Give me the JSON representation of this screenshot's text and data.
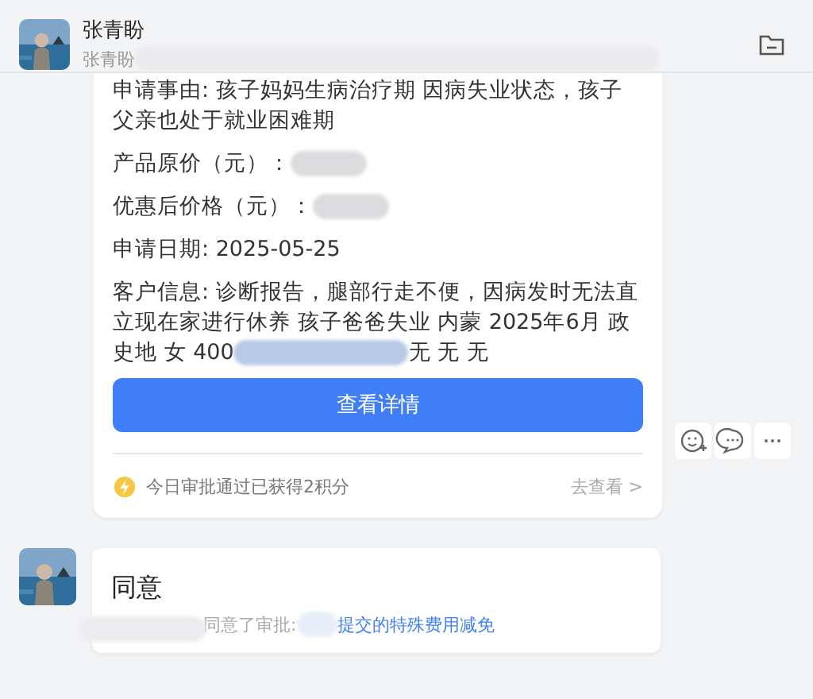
{
  "header": {
    "name": "张青盼",
    "subtitle": "张青盼"
  },
  "approval_card": {
    "fields": [
      {
        "parts": [
          "申请事由: 孩子妈妈生病治疗期 因病失业状态，孩子父亲也处于就业困难期"
        ],
        "redacted_end": false
      },
      {
        "parts": [
          "产品原价（元）："
        ],
        "redacted_end": true
      },
      {
        "parts": [
          "优惠后价格（元）："
        ],
        "redacted_end": true
      },
      {
        "parts": [
          "申请日期: 2025-05-25"
        ],
        "redacted_end": false
      },
      {
        "parts": [
          "客户信息: 诊断报告，腿部行走不便，因病发时无法直立现在家进行休养 孩子爸爸失业 内蒙 2025年6月 政史地 女 400",
          "无 无 无"
        ],
        "redacted_end": false
      }
    ],
    "button": "查看详情",
    "points_note": "今日审批通过已获得2积分",
    "view_link": "去查看 >"
  },
  "comment_card": {
    "title": "同意",
    "note": "同意了审批:",
    "link": "提交的特殊费用减免"
  }
}
